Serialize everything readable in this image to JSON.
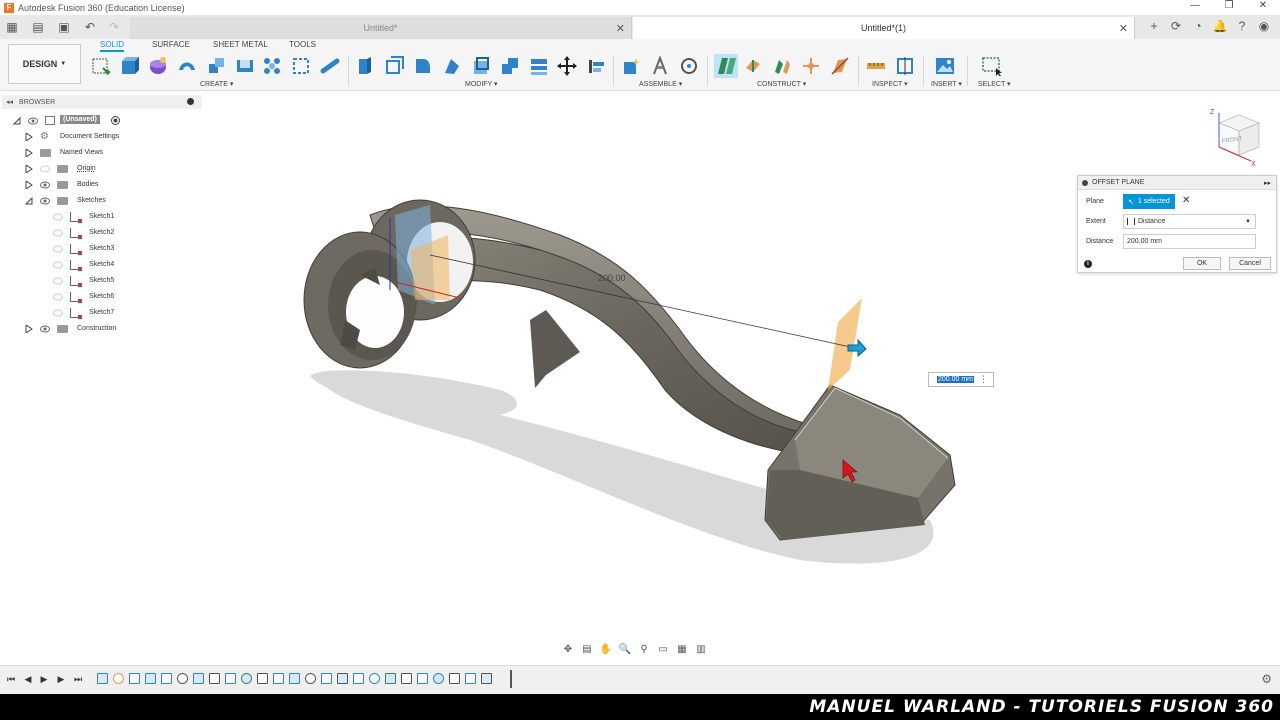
{
  "window": {
    "title": "Autodesk Fusion 360 (Education License)",
    "logo_letter": "F",
    "controls": [
      "—",
      "❐",
      "✕"
    ]
  },
  "tabs": {
    "inactive": "Untitled*",
    "active": "Untitled*(1)"
  },
  "ribbon": {
    "workspace": "DESIGN",
    "tabs": [
      "SOLID",
      "SURFACE",
      "SHEET METAL",
      "TOOLS"
    ],
    "groups": [
      "CREATE",
      "MODIFY",
      "ASSEMBLE",
      "CONSTRUCT",
      "INSPECT",
      "INSERT",
      "SELECT"
    ]
  },
  "browser": {
    "title": "BROWSER",
    "root": "(Unsaved)",
    "items": [
      "Document Settings",
      "Named Views",
      "Origin",
      "Bodies",
      "Sketches",
      "Construction"
    ],
    "sketches": [
      "Sketch1",
      "Sketch2",
      "Sketch3",
      "Sketch4",
      "Sketch5",
      "Sketch6",
      "Sketch7"
    ]
  },
  "viewport": {
    "dimension_label": "200.00",
    "value_field": "200.00 mm"
  },
  "dialog": {
    "title": "OFFSET PLANE",
    "plane_label": "Plane",
    "plane_value": "1 selected",
    "extent_label": "Extent",
    "extent_value": "Distance",
    "distance_label": "Distance",
    "distance_value": "200.00 mm",
    "ok": "OK",
    "cancel": "Cancel"
  },
  "viewcube": {
    "front": "FRONT",
    "axis_z": "Z",
    "axis_x": "X"
  },
  "watermark": "MANUEL WARLAND - TUTORIELS FUSION 360",
  "colors": {
    "accent": "#0696d7",
    "body": "#6e6a60",
    "plane": "#f2b25c"
  }
}
